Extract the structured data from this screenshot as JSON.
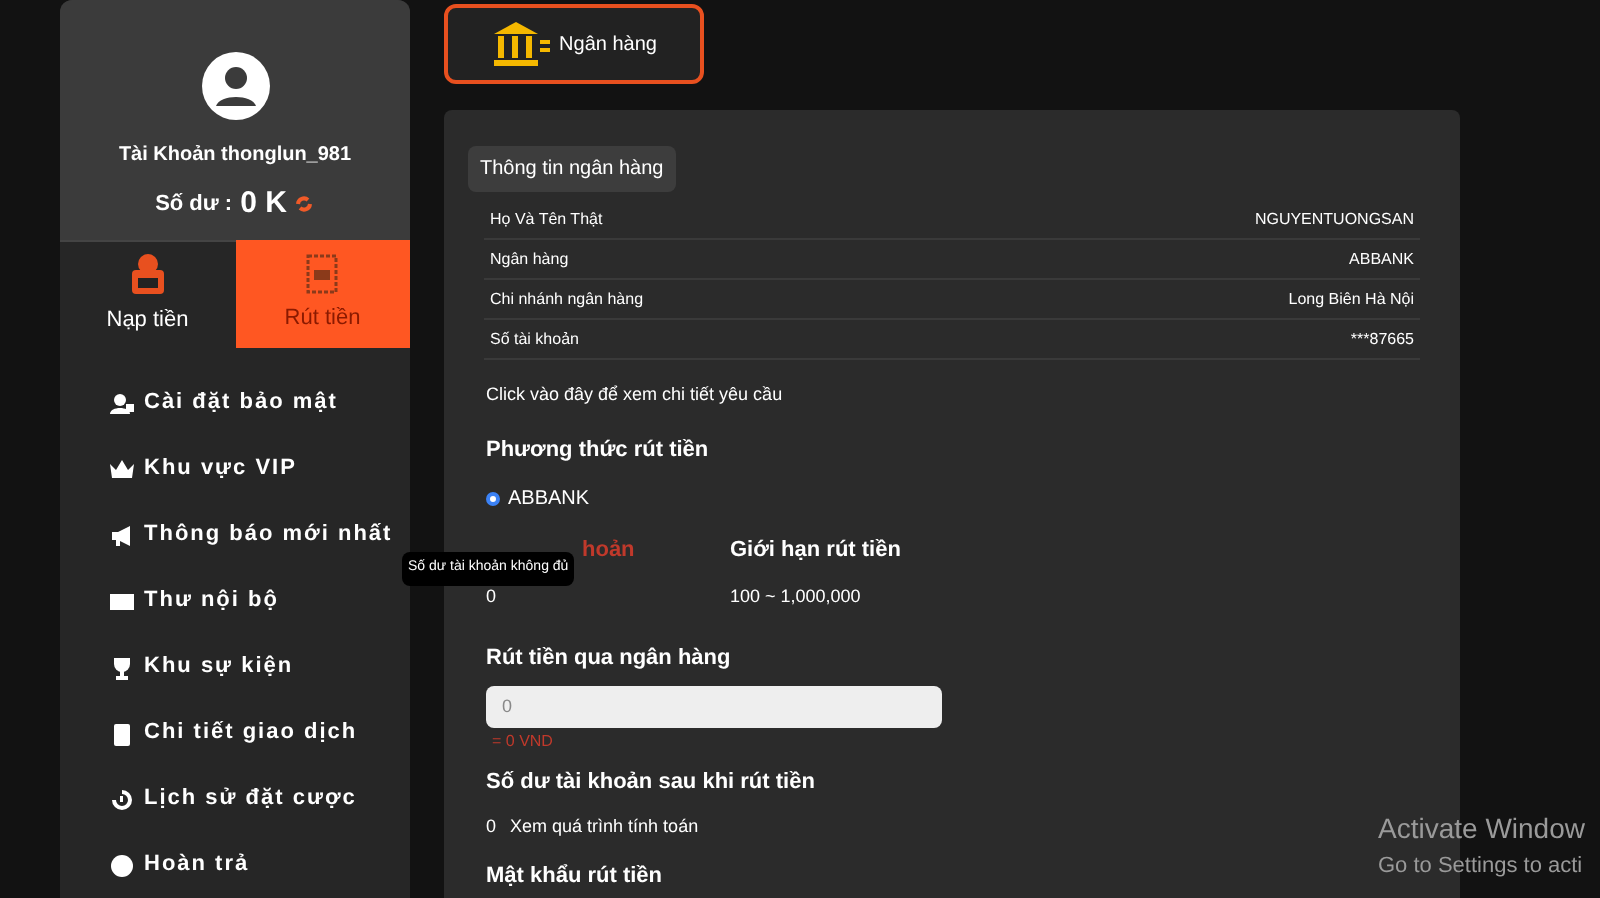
{
  "account": {
    "label": "Tài Khoản thonglun_981",
    "balance_label": "Số dư :",
    "balance": "0 K"
  },
  "tabs": [
    {
      "label": "Nạp tiền",
      "selected": false
    },
    {
      "label": "Rút tiền",
      "selected": true
    }
  ],
  "menu": [
    {
      "label": "Cài đặt bảo mật"
    },
    {
      "label": "Khu vực VIP"
    },
    {
      "label": "Thông báo mới nhất"
    },
    {
      "label": "Thư nội bộ"
    },
    {
      "label": "Khu sự kiện"
    },
    {
      "label": "Chi tiết giao dịch"
    },
    {
      "label": "Lịch sử đặt cược"
    },
    {
      "label": "Hoàn trả"
    }
  ],
  "method_tab": {
    "label": "Ngân hàng",
    "selected": true
  },
  "bank_info": {
    "title": "Thông tin ngân hàng",
    "rows": [
      {
        "label": "Họ Và Tên Thật",
        "value": "NGUYENTUONGSAN"
      },
      {
        "label": "Ngân hàng",
        "value": "ABBANK"
      },
      {
        "label": "Chi nhánh ngân hàng",
        "value": "Long Biên Hà Nội"
      },
      {
        "label": "Số tài khoản",
        "value": "***87665"
      }
    ],
    "link": "Click vào đây để xem chi tiết yêu cầu"
  },
  "withdraw_method": {
    "title": "Phương thức rút tiền",
    "options": [
      {
        "label": "ABBANK",
        "selected": true
      }
    ]
  },
  "balance_col": {
    "label": "hoản",
    "value": "0"
  },
  "limit_col": {
    "label": "Giới hạn rút tiền",
    "value": "100 ~ 1,000,000"
  },
  "tooltip": "Số dư tài khoản không đủ",
  "amount": {
    "label": "Rút tiền qua ngân hàng",
    "placeholder": "0",
    "hint": "= 0 VND"
  },
  "after": {
    "label": "Số dư tài khoản sau khi rút tiền",
    "value": "0",
    "link": "Xem quá trình tính toán"
  },
  "password": {
    "label": "Mật khẩu rút tiền"
  },
  "os_notice": {
    "title": "Activate Window",
    "subtitle": "Go to Settings to acti"
  }
}
